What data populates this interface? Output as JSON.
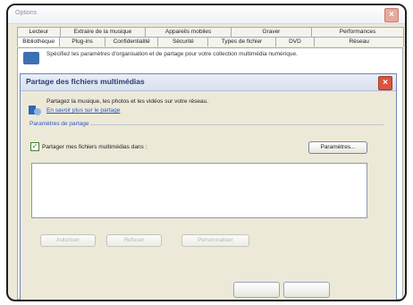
{
  "outer_window": {
    "title": "Options",
    "tabs_row1": [
      "Lecteur",
      "Extraire de la musique",
      "Appareils mobiles",
      "Graver",
      "Performances"
    ],
    "tabs_row2": [
      "Bibliothèque",
      "Plug-ins",
      "Confidentialité",
      "Sécurité",
      "Types de fichier",
      "DVD",
      "Réseau"
    ],
    "active_tab": "Bibliothèque",
    "description": "Spécifiez les paramètres d'organisation et de partage pour votre collection multimédia numérique."
  },
  "dialog": {
    "title": "Partage des fichiers multimédias",
    "description": "Partagez la musique, les photos et les vidéos sur votre réseau.",
    "link": "En savoir plus sur le partage",
    "section_label": "Paramètres de partage",
    "share_checkbox_label": "Partager mes fichiers multimédias dans :",
    "share_checked": true,
    "params_button": "Paramètres...",
    "allow_button": "Autoriser",
    "deny_button": "Refuser",
    "customize_button": "Personnaliser"
  },
  "colors": {
    "dialog_bg": "#ece9d8",
    "link": "#2b56c6",
    "close_button": "#d9553d"
  },
  "icons": [
    "close-icon",
    "media-sharing-icon",
    "library-icon",
    "checkmark-icon"
  ]
}
